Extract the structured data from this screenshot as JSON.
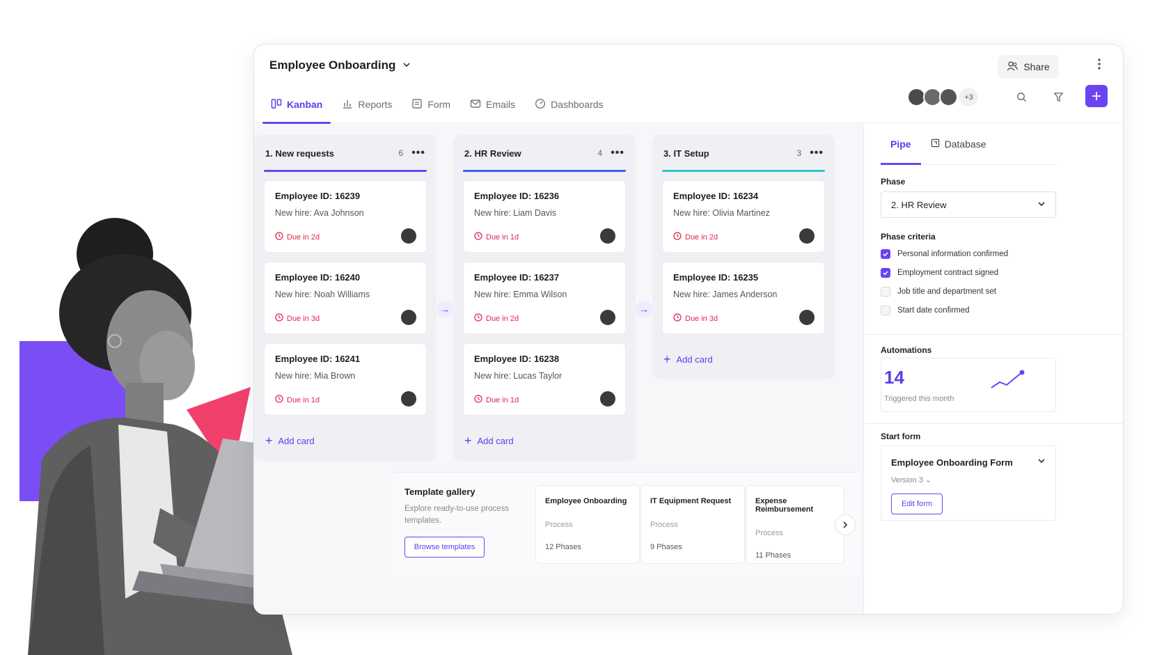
{
  "app": {
    "title": "Employee Onboarding",
    "share_label": "Share",
    "tabs": [
      {
        "label": "Kanban",
        "icon": "kanban-icon",
        "active": true
      },
      {
        "label": "Reports",
        "icon": "bar-chart-icon",
        "active": false
      },
      {
        "label": "Form",
        "icon": "form-icon",
        "active": false
      },
      {
        "label": "Emails",
        "icon": "mail-icon",
        "active": false
      },
      {
        "label": "Dashboards",
        "icon": "gauge-icon",
        "active": false
      }
    ],
    "avatars_more": "+3",
    "accent": "#6a44f2"
  },
  "columns": [
    {
      "title": "1. New requests",
      "count": "6",
      "bar_color": "#6a44f2",
      "cards": [
        {
          "id": "Employee ID: 16239",
          "hire": "New hire: Ava Johnson",
          "due": "Due in 2d"
        },
        {
          "id": "Employee ID: 16240",
          "hire": "New hire: Noah Williams",
          "due": "Due in 3d"
        },
        {
          "id": "Employee ID: 16241",
          "hire": "New hire: Mia Brown",
          "due": "Due in 1d"
        }
      ],
      "add_label": "Add card"
    },
    {
      "title": "2. HR Review",
      "count": "4",
      "bar_color": "#3d5ef5",
      "cards": [
        {
          "id": "Employee ID: 16236",
          "hire": "New hire: Liam Davis",
          "due": "Due in 1d"
        },
        {
          "id": "Employee ID: 16237",
          "hire": "New hire: Emma Wilson",
          "due": "Due in 2d"
        },
        {
          "id": "Employee ID: 16238",
          "hire": "New hire: Lucas Taylor",
          "due": "Due in 1d"
        }
      ],
      "add_label": "Add card"
    },
    {
      "title": "3. IT Setup",
      "count": "3",
      "bar_color": "#2cc7c4",
      "cards": [
        {
          "id": "Employee ID: 16234",
          "hire": "New hire: Olivia Martinez",
          "due": "Due in 2d"
        },
        {
          "id": "Employee ID: 16235",
          "hire": "New hire: James Anderson",
          "due": "Due in 3d"
        }
      ],
      "add_label": "Add card"
    }
  ],
  "gallery": {
    "title": "Template gallery",
    "description": "Explore ready-to-use process templates.",
    "button": "Browse templates",
    "templates": [
      {
        "name": "Employee Onboarding",
        "type": "Process",
        "phases": "12 Phases"
      },
      {
        "name": "IT Equipment Request",
        "type": "Process",
        "phases": "9 Phases"
      },
      {
        "name": "Expense Reimbursement",
        "type": "Process",
        "phases": "11 Phases"
      }
    ]
  },
  "panel": {
    "tabs": [
      {
        "label": "Pipe",
        "active": true
      },
      {
        "label": "Database",
        "icon": "database-icon",
        "active": false
      }
    ],
    "phase_label": "Phase",
    "phase_value": "2. HR Review",
    "criteria_label": "Phase criteria",
    "criteria": [
      {
        "label": "Personal information confirmed",
        "checked": true
      },
      {
        "label": "Employment contract signed",
        "checked": true
      },
      {
        "label": "Job title and department set",
        "checked": false
      },
      {
        "label": "Start date confirmed",
        "checked": false
      }
    ],
    "automations_label": "Automations",
    "automations_count": "14",
    "automations_caption": "Triggered this month",
    "start_form_label": "Start form",
    "form_name": "Employee Onboarding Form",
    "form_version": "Version 3",
    "edit_form": "Edit form"
  }
}
